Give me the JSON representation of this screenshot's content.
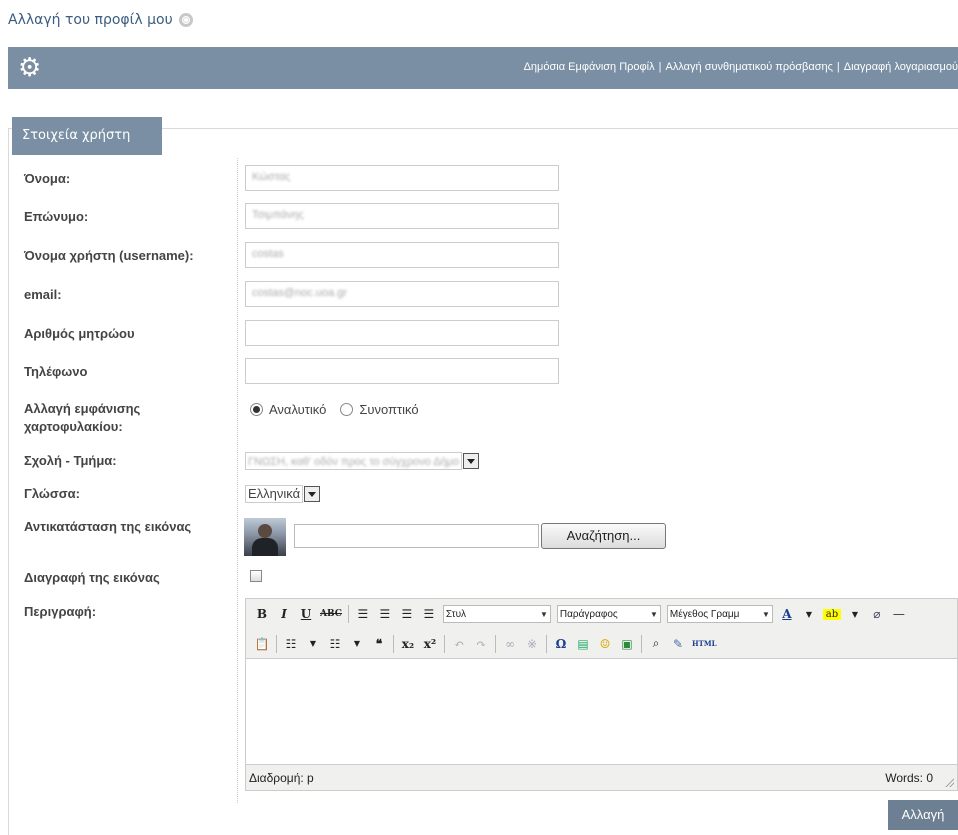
{
  "page": {
    "title": "Αλλαγή του προφίλ μου"
  },
  "topbar": {
    "links": [
      "Δημόσια Εμφάνιση Προφίλ",
      "Αλλαγή συνθηματικού πρόσβασης",
      "Διαγραφή λογαριασμού"
    ],
    "separator": "|"
  },
  "section": {
    "legend": "Στοιχεία χρήστη"
  },
  "form": {
    "first_name": {
      "label": "Όνομα:",
      "value": "Κώστας"
    },
    "last_name": {
      "label": "Επώνυμο:",
      "value": "Τσιμπάνης"
    },
    "username": {
      "label": "Όνομα χρήστη (username):",
      "value": "costas"
    },
    "email": {
      "label": "email:",
      "value": "costas@noc.uoa.gr"
    },
    "registry": {
      "label": "Αριθμός μητρώου",
      "value": ""
    },
    "phone": {
      "label": "Τηλέφωνο",
      "value": ""
    },
    "portfolio": {
      "label_line1": "Αλλαγή εμφάνισης",
      "label_line2": "χαρτοφυλακίου:",
      "option1": "Αναλυτικό",
      "option2": "Συνοπτικό",
      "selected": "Αναλυτικό"
    },
    "department": {
      "label": "Σχολή - Τμήμα:",
      "value": "ΓΝΩΣΗ, καθ' οδόν προς το σύγχρονο Δήμο"
    },
    "language": {
      "label": "Γλώσσα:",
      "value": "Ελληνικά"
    },
    "image": {
      "label": "Αντικατάσταση της εικόνας",
      "browse": "Αναζήτηση..."
    },
    "delete_image": {
      "label": "Διαγραφή της εικόνας"
    },
    "description": {
      "label": "Περιγραφή:"
    }
  },
  "editor": {
    "style_select": "Στυλ",
    "format_select": "Παράγραφος",
    "size_select": "Μέγεθος Γραμμ",
    "path": "Διαδρομή: p",
    "words": "Words: 0"
  },
  "submit": {
    "label": "Αλλαγή"
  }
}
